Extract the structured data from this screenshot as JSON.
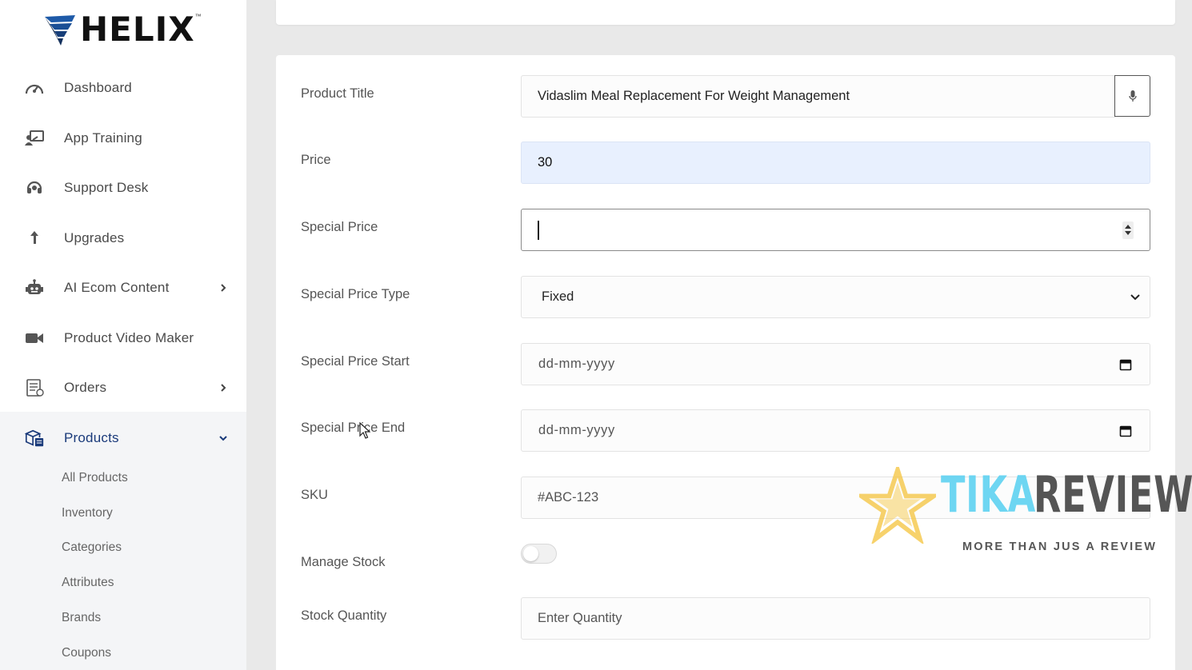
{
  "app": {
    "logo_text": "HELIX",
    "logo_tm": "™"
  },
  "sidebar": {
    "items": [
      {
        "label": "Dashboard",
        "icon": "gauge-icon"
      },
      {
        "label": "App Training",
        "icon": "training-icon"
      },
      {
        "label": "Support Desk",
        "icon": "headset-icon"
      },
      {
        "label": "Upgrades",
        "icon": "arrow-up-icon"
      },
      {
        "label": "AI Ecom Content",
        "icon": "robot-icon"
      },
      {
        "label": "Product Video Maker",
        "icon": "video-camera-icon"
      },
      {
        "label": "Orders",
        "icon": "receipt-icon"
      },
      {
        "label": "Products",
        "icon": "boxes-icon"
      }
    ],
    "products_submenu": [
      "All Products",
      "Inventory",
      "Categories",
      "Attributes",
      "Brands",
      "Coupons"
    ]
  },
  "form": {
    "product_title_label": "Product Title",
    "product_title_value": "Vidaslim Meal Replacement For Weight Management",
    "price_label": "Price",
    "price_value": "30",
    "special_price_label": "Special Price",
    "special_price_type_label": "Special Price Type",
    "special_price_type_value": "Fixed",
    "special_price_start_label": "Special Price Start",
    "special_price_start_placeholder": "dd-mm-yyyy",
    "special_price_end_label": "Special Price End",
    "special_price_end_placeholder": "dd-mm-yyyy",
    "sku_label": "SKU",
    "sku_placeholder": "#ABC-123",
    "manage_stock_label": "Manage Stock",
    "manage_stock_on": false,
    "stock_quantity_label": "Stock Quantity",
    "stock_quantity_placeholder": "Enter Quantity"
  },
  "watermark": {
    "word1": "TIKA",
    "word2": "REVIEW",
    "tagline": "MORE THAN JUS A REVIEW"
  },
  "colors": {
    "accent": "#1a3a7a",
    "price_field_bg": "#e8f0fe",
    "watermark_blue": "#5fd2f2",
    "watermark_star": "#f5c84a"
  }
}
